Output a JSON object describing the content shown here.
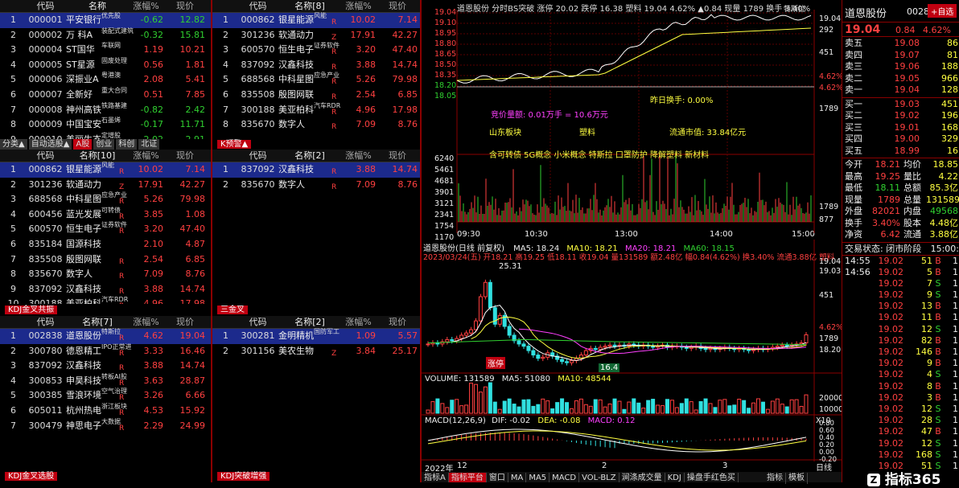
{
  "headers": {
    "code": "代码",
    "name": "名称",
    "pct": "涨幅%",
    "price": "现价",
    "name8": "名称[8]",
    "name10": "名称[10]",
    "name2": "名称[2]",
    "name7": "名称[7]"
  },
  "p1": {
    "rows": [
      {
        "idx": "1",
        "code": "000001",
        "name": "平安银行",
        "tag": "优先股",
        "pct": "-0.62",
        "price": "12.82",
        "pc": "g",
        "sel": true
      },
      {
        "idx": "2",
        "code": "000002",
        "name": "万 科A",
        "tag": "装配式建筑",
        "pct": "-0.32",
        "price": "15.81",
        "pc": "g"
      },
      {
        "idx": "3",
        "code": "000004",
        "name": "ST国华",
        "tag": "车联网",
        "pct": "1.19",
        "price": "10.21",
        "pc": "r"
      },
      {
        "idx": "4",
        "code": "000005",
        "name": "ST星源",
        "tag": "固废处理",
        "pct": "0.56",
        "price": "1.81",
        "pc": "r"
      },
      {
        "idx": "5",
        "code": "000006",
        "name": "深振业A",
        "tag": "粤港澳",
        "pct": "2.08",
        "price": "5.41",
        "pc": "r"
      },
      {
        "idx": "6",
        "code": "000007",
        "name": "全新好",
        "tag": "重大合同",
        "pct": "0.51",
        "price": "7.85",
        "pc": "r"
      },
      {
        "idx": "7",
        "code": "000008",
        "name": "神州高铁",
        "tag": "铁路基建",
        "pct": "-0.82",
        "price": "2.42",
        "pc": "g"
      },
      {
        "idx": "8",
        "code": "000009",
        "name": "中国宝安",
        "tag": "石墨烯",
        "pct": "-0.17",
        "price": "11.71",
        "pc": "g"
      },
      {
        "idx": "9",
        "code": "000010",
        "name": "美丽生态",
        "tag": "定增股",
        "pct": "-2.02",
        "price": "2.91",
        "pc": "g"
      }
    ]
  },
  "p2": {
    "rows": [
      {
        "idx": "1",
        "code": "000862",
        "name": "银星能源",
        "tag": "风能",
        "r": "R",
        "pct": "10.02",
        "price": "7.14",
        "pc": "r",
        "sel": true
      },
      {
        "idx": "2",
        "code": "301236",
        "name": "软通动力",
        "tag": "",
        "r": "Z",
        "pct": "17.91",
        "price": "42.27",
        "pc": "r"
      },
      {
        "idx": "3",
        "code": "600570",
        "name": "恒生电子",
        "tag": "证券软件",
        "r": "R",
        "pct": "3.20",
        "price": "47.40",
        "pc": "r"
      },
      {
        "idx": "4",
        "code": "837092",
        "name": "汉鑫科技",
        "tag": "",
        "r": "R",
        "pct": "3.88",
        "price": "14.74",
        "pc": "r"
      },
      {
        "idx": "5",
        "code": "688568",
        "name": "中科星图",
        "tag": "应急产业",
        "r": "R",
        "pct": "5.26",
        "price": "79.98",
        "pc": "r"
      },
      {
        "idx": "6",
        "code": "835508",
        "name": "殷图网联",
        "tag": "",
        "r": "R",
        "pct": "2.54",
        "price": "6.85",
        "pc": "r"
      },
      {
        "idx": "7",
        "code": "300188",
        "name": "美亚柏科",
        "tag": "汽车RDR",
        "r": "R",
        "pct": "4.96",
        "price": "17.98",
        "pc": "r"
      },
      {
        "idx": "8",
        "code": "835670",
        "name": "数字人",
        "tag": "",
        "r": "R",
        "pct": "7.09",
        "price": "8.76",
        "pc": "r"
      }
    ]
  },
  "tabs1": [
    "分类▲",
    "自动选股▲",
    "A股",
    "创业",
    "科创",
    "北证"
  ],
  "tabs2": "K预警▲",
  "p3": {
    "rows": [
      {
        "idx": "1",
        "code": "000862",
        "name": "银星能源",
        "tag": "风能",
        "r": "R",
        "pct": "10.02",
        "price": "7.14",
        "pc": "r",
        "sel": true
      },
      {
        "idx": "2",
        "code": "301236",
        "name": "软通动力",
        "tag": "",
        "r": "Z",
        "pct": "17.91",
        "price": "42.27",
        "pc": "r"
      },
      {
        "idx": "3",
        "code": "688568",
        "name": "中科星图",
        "tag": "应急产业",
        "r": "R",
        "pct": "5.26",
        "price": "79.98",
        "pc": "r"
      },
      {
        "idx": "4",
        "code": "600456",
        "name": "蓝光发展",
        "tag": "可转债",
        "r": "R",
        "pct": "3.85",
        "price": "1.08",
        "pc": "r"
      },
      {
        "idx": "5",
        "code": "600570",
        "name": "恒生电子",
        "tag": "证券软件",
        "r": "R",
        "pct": "3.20",
        "price": "47.40",
        "pc": "r"
      },
      {
        "idx": "6",
        "code": "835184",
        "name": "国源科技",
        "tag": "",
        "r": "",
        "pct": "2.10",
        "price": "4.87",
        "pc": "r"
      },
      {
        "idx": "7",
        "code": "835508",
        "name": "殷图网联",
        "tag": "",
        "r": "R",
        "pct": "2.54",
        "price": "6.85",
        "pc": "r"
      },
      {
        "idx": "8",
        "code": "835670",
        "name": "数字人",
        "tag": "",
        "r": "R",
        "pct": "7.09",
        "price": "8.76",
        "pc": "r"
      },
      {
        "idx": "9",
        "code": "837092",
        "name": "汉鑫科技",
        "tag": "",
        "r": "R",
        "pct": "3.88",
        "price": "14.74",
        "pc": "r"
      },
      {
        "idx": "10",
        "code": "300188",
        "name": "美亚柏科",
        "tag": "汽车RDR",
        "r": "R",
        "pct": "4.96",
        "price": "17.98",
        "pc": "r"
      }
    ]
  },
  "p4": {
    "rows": [
      {
        "idx": "1",
        "code": "837092",
        "name": "汉鑫科技",
        "tag": "",
        "r": "R",
        "pct": "3.88",
        "price": "14.74",
        "pc": "r",
        "sel": true
      },
      {
        "idx": "2",
        "code": "835670",
        "name": "数字人",
        "tag": "",
        "r": "R",
        "pct": "7.09",
        "price": "8.76",
        "pc": "r"
      }
    ]
  },
  "label_kdj_gold": "KDJ金叉共振",
  "label_sanjin": "三金叉",
  "p5": {
    "rows": [
      {
        "idx": "1",
        "code": "002838",
        "name": "道恩股份",
        "tag": "特斯拉",
        "r": "R",
        "pct": "4.62",
        "price": "19.04",
        "pc": "r",
        "sel": true
      },
      {
        "idx": "2",
        "code": "300780",
        "name": "德恩精工",
        "tag": "IPO正常进",
        "r": "R",
        "pct": "3.33",
        "price": "16.46",
        "pc": "r"
      },
      {
        "idx": "3",
        "code": "837092",
        "name": "汉鑫科技",
        "tag": "",
        "r": "R",
        "pct": "3.88",
        "price": "14.74",
        "pc": "r"
      },
      {
        "idx": "4",
        "code": "300853",
        "name": "申昊科技",
        "tag": "转板AI股",
        "r": "R",
        "pct": "3.63",
        "price": "28.87",
        "pc": "r"
      },
      {
        "idx": "5",
        "code": "300385",
        "name": "雪浪环境",
        "tag": "空气治理",
        "r": "R",
        "pct": "3.26",
        "price": "6.66",
        "pc": "r"
      },
      {
        "idx": "6",
        "code": "605011",
        "name": "杭州热电",
        "tag": "浙江板块",
        "r": "R",
        "pct": "4.53",
        "price": "15.92",
        "pc": "r"
      },
      {
        "idx": "7",
        "code": "300479",
        "name": "神思电子",
        "tag": "大数据",
        "r": "R",
        "pct": "2.29",
        "price": "24.99",
        "pc": "r"
      }
    ]
  },
  "p6": {
    "rows": [
      {
        "idx": "1",
        "code": "300281",
        "name": "金明精机",
        "tag": "国防军工",
        "r": "",
        "pct": "1.09",
        "price": "5.57",
        "pc": "r",
        "sel": true
      },
      {
        "idx": "2",
        "code": "301156",
        "name": "美农生物",
        "tag": "",
        "r": "Z",
        "pct": "3.84",
        "price": "25.17",
        "pc": "r"
      }
    ]
  },
  "label_kdj_sel": "KDJ金叉选股",
  "label_kdj_break": "KDJ突破增强",
  "intraday": {
    "title": "道恩股份  分时BS突破  涨停 20.02 跌停 16.38 塑料 19.04 4.62% ▲0.84 现量 1789 换手 3.40%",
    "title2": "特斯拉",
    "ylabels": [
      "19.04",
      "19.10",
      "18.95",
      "18.80",
      "18.65",
      "18.50",
      "18.35",
      "18.20",
      "18.05"
    ],
    "rlabels": [
      "19.04",
      "292",
      "451",
      "4.62%",
      "4.62%",
      "1789"
    ],
    "info1": "昨日换手: 0.00%",
    "info2": "竞价量额: 0.01万手 = 10.6万元",
    "info3a": "山东板块",
    "info3b": "塑料",
    "info3c": "流通市值: 33.84亿元",
    "info4": "含可转债 5G概念 小米概念 特斯拉 口罩防护 降解塑料 新材料",
    "vol_labels": [
      "6240",
      "5461",
      "4681",
      "3901",
      "3121",
      "2341",
      "1754",
      "1170",
      "877"
    ],
    "times": [
      "09:30",
      "10:30",
      "13:00",
      "14:00",
      "15:00"
    ],
    "rvol": [
      "1789",
      "877"
    ]
  },
  "kline": {
    "title": "道恩股份(日线 前复权)",
    "ma5": "MA5: 18.24",
    "ma10": "MA10: 18.21",
    "ma20": "MA20: 18.21",
    "ma60": "MA60: 18.15",
    "line2": "2023/03/24(五) 开18.21 高19.25 低18.11 收19.04 量131589 额2.48亿 幅0.84(4.62%) 换3.40% 流通3.88亿 塑料",
    "peak": "25.31",
    "zt": "涨停",
    "low": "16.4",
    "rlabels": [
      "19.04",
      "19.03",
      "451",
      "4.62%",
      "1789",
      "18.20"
    ],
    "vol": "VOLUME: 131589",
    "vma5": "MA5: 51080",
    "vma10": "MA10: 48544",
    "vr": [
      "20000",
      "10000",
      "X10"
    ],
    "macd": "MACD(12,26,9)",
    "dif": "DIF: -0.02",
    "dea": "DEA: -0.08",
    "macd_v": "MACD: 0.12",
    "mr": [
      "0.80",
      "0.60",
      "0.40",
      "0.20",
      "0.00",
      "-0.20"
    ],
    "dates": [
      "2022年",
      "12",
      "2",
      "3"
    ],
    "period": "日线",
    "xvals": [
      0,
      1,
      2,
      3,
      4,
      5,
      6,
      7,
      8,
      9,
      10,
      11,
      12,
      13,
      14,
      15,
      16,
      17,
      18,
      19,
      20,
      21,
      22,
      23,
      24,
      25,
      26,
      27,
      28,
      29,
      30,
      31,
      32,
      33,
      34,
      35,
      36,
      37,
      38,
      39,
      40,
      41,
      42,
      43,
      44,
      45,
      46,
      47,
      48,
      49,
      50,
      51,
      52,
      53,
      54,
      55,
      56,
      57,
      58,
      59,
      60,
      61,
      62,
      63,
      64,
      65,
      66,
      67,
      68,
      69,
      70,
      71,
      72,
      73,
      74,
      75,
      76,
      77,
      78,
      79
    ],
    "closes": [
      18.2,
      18.3,
      18.2,
      18.4,
      18.6,
      18.5,
      18.7,
      19.0,
      19.2,
      19.5,
      20.3,
      22.5,
      23.8,
      21.5,
      20.0,
      20.8,
      19.8,
      19.0,
      18.5,
      18.2,
      18.0,
      17.6,
      17.2,
      16.9,
      17.0,
      17.4,
      17.1,
      16.8,
      16.6,
      16.5,
      16.7,
      16.9,
      17.2,
      17.6,
      17.8,
      17.7,
      17.9,
      18.0,
      18.1,
      18.0,
      18.1,
      18.0,
      18.2,
      18.1,
      18.0,
      18.1,
      18.0,
      17.9,
      18.0,
      18.1,
      17.9,
      18.0,
      18.0,
      17.9,
      17.8,
      17.9,
      18.0,
      17.8,
      17.7,
      17.8,
      17.7,
      17.8,
      17.9,
      17.8,
      17.7,
      17.8,
      17.7,
      17.6,
      17.7,
      17.8,
      17.7,
      17.8,
      17.9,
      18.0,
      18.1,
      18.0,
      18.1,
      18.2,
      18.3,
      19.04
    ]
  },
  "quote": {
    "name": "道恩股份",
    "code": "0028",
    "price": "19.04",
    "chg": "0.84",
    "pct": "4.62%",
    "btn": "+自选",
    "asks": [
      [
        "卖五",
        "19.08",
        "86"
      ],
      [
        "卖四",
        "19.07",
        "81"
      ],
      [
        "卖三",
        "19.06",
        "188"
      ],
      [
        "卖二",
        "19.05",
        "966"
      ],
      [
        "卖一",
        "19.04",
        "128"
      ]
    ],
    "bids": [
      [
        "买一",
        "19.03",
        "451"
      ],
      [
        "买二",
        "19.02",
        "196"
      ],
      [
        "买三",
        "19.01",
        "168"
      ],
      [
        "买四",
        "19.00",
        "329"
      ],
      [
        "买五",
        "18.99",
        "16"
      ]
    ],
    "stats": [
      [
        "今开",
        "18.21",
        "均价",
        "18.85"
      ],
      [
        "最高",
        "19.25",
        "量比",
        "4.22"
      ],
      [
        "最低",
        "18.11",
        "总额",
        "85.3亿"
      ],
      [
        "现量",
        "1789",
        "总量",
        "131589"
      ],
      [
        "外盘",
        "82021",
        "内盘",
        "49568"
      ],
      [
        "换手",
        "3.40%",
        "股本",
        "4.48亿"
      ],
      [
        "净资",
        "6.42",
        "流通",
        "3.88亿"
      ]
    ],
    "status": "交易状态: 闭市阶段",
    "status_t": "15:00:",
    "ticks": [
      [
        "14:55",
        "19.02",
        "51",
        "B",
        "1"
      ],
      [
        "14:56",
        "19.02",
        "5",
        "B",
        "1"
      ],
      [
        "",
        "19.02",
        "7",
        "S",
        "1"
      ],
      [
        "",
        "19.02",
        "9",
        "S",
        "1"
      ],
      [
        "",
        "19.02",
        "13",
        "B",
        "1"
      ],
      [
        "",
        "19.02",
        "11",
        "B",
        "1"
      ],
      [
        "",
        "19.02",
        "12",
        "S",
        "1"
      ],
      [
        "",
        "19.02",
        "82",
        "B",
        "1"
      ],
      [
        "",
        "19.02",
        "146",
        "B",
        "1"
      ],
      [
        "",
        "19.02",
        "9",
        "B",
        "1"
      ],
      [
        "",
        "19.02",
        "4",
        "S",
        "1"
      ],
      [
        "",
        "19.02",
        "8",
        "B",
        "1"
      ],
      [
        "",
        "19.02",
        "3",
        "B",
        "1"
      ],
      [
        "",
        "19.02",
        "12",
        "S",
        "1"
      ],
      [
        "",
        "19.02",
        "28",
        "S",
        "1"
      ],
      [
        "",
        "19.02",
        "47",
        "B",
        "1"
      ],
      [
        "",
        "19.02",
        "12",
        "S",
        "1"
      ],
      [
        "",
        "19.02",
        "168",
        "S",
        "1"
      ],
      [
        "",
        "19.02",
        "51",
        "S",
        "1"
      ]
    ]
  },
  "bottom": [
    "指标A",
    "指标平台",
    "窗口",
    "MA",
    "MA5",
    "MACD",
    "VOL-BLZ",
    "涧涤成交量",
    "KDJ",
    "操盘手红色买"
  ],
  "bottom_right": [
    "指标",
    "模板"
  ],
  "brand": "指标365"
}
